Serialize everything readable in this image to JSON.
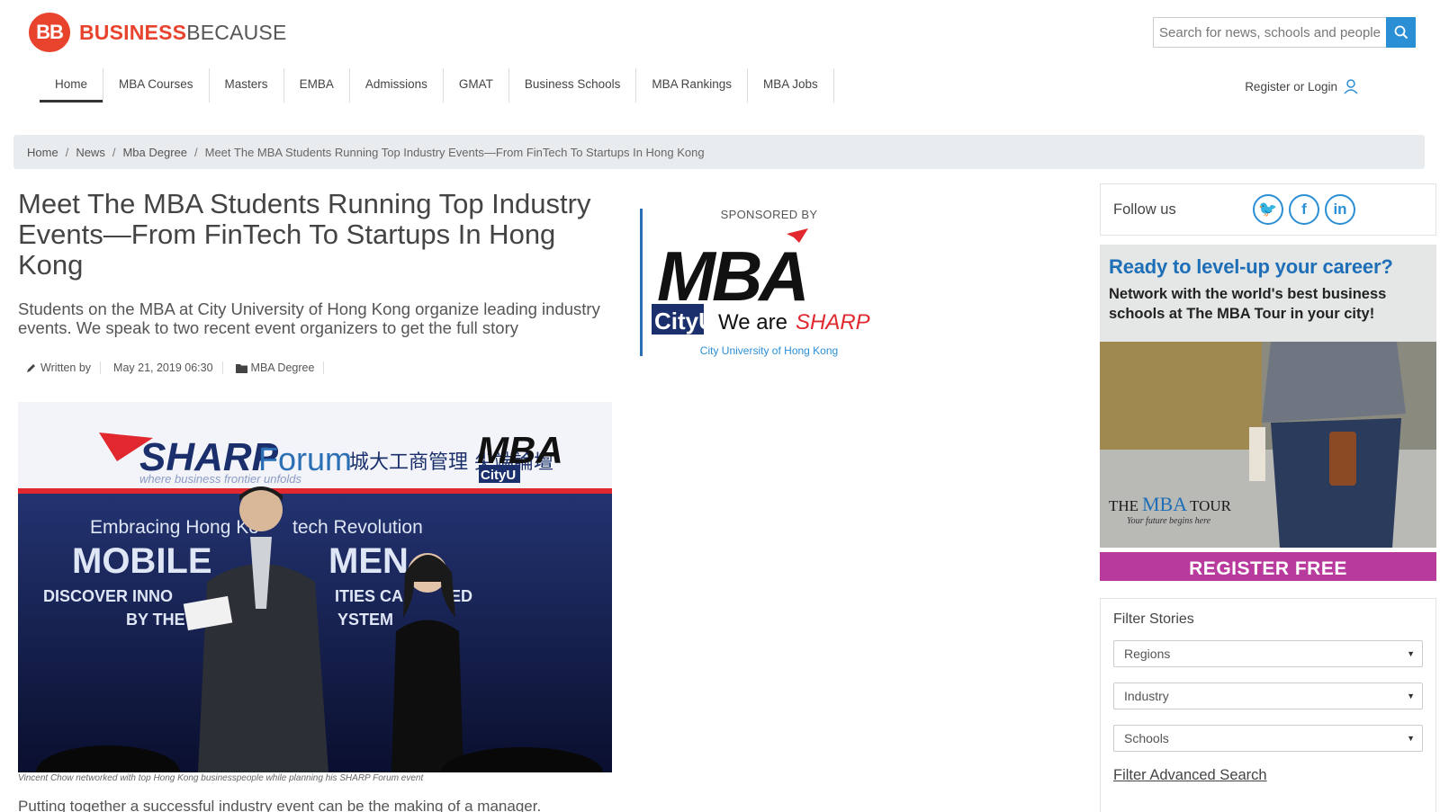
{
  "header": {
    "logo_badge": "BB",
    "logo_brand_part1": "BUSINESS",
    "logo_brand_part2": "BECAUSE",
    "search_placeholder": "Search for news, schools and people...",
    "register_label": "Register or Login"
  },
  "nav": {
    "items": [
      "Home",
      "MBA Courses",
      "Masters",
      "EMBA",
      "Admissions",
      "GMAT",
      "Business Schools",
      "MBA Rankings",
      "MBA Jobs"
    ],
    "active": "Home"
  },
  "breadcrumb": {
    "items": [
      "Home",
      "News",
      "Mba Degree"
    ],
    "current": "Meet The MBA Students Running Top Industry Events—From FinTech To Startups In Hong Kong"
  },
  "article": {
    "title": "Meet The MBA Students Running Top Industry Events—From FinTech To Startups In Hong Kong",
    "subtitle": "Students on the MBA at City University of Hong Kong organize leading industry events. We speak to two recent event organizers to get the full story",
    "written_by": "Written by",
    "date": "May 21, 2019 06:30",
    "category": "MBA Degree",
    "photo_caption": "Vincent Chow networked with top Hong Kong businesspeople while planning his SHARP Forum event",
    "lead": "Putting together a successful industry event can be the making of a manager."
  },
  "photo": {
    "banner_brand": "SHARP",
    "banner_forum": "Forum",
    "banner_tagline": "where business frontier unfolds",
    "banner_chinese": "城大工商管理 尖端論壇",
    "banner_mba": "MBA",
    "banner_cityu": "CityU",
    "screen_line1": "Embracing Hong Ko",
    "screen_line1b": "tech Revolution",
    "screen_line2": "MOBILE",
    "screen_line2b": "MEN",
    "screen_line3": "DISCOVER INNO",
    "screen_line3b": "ITIES CA",
    "screen_line3c": "ED",
    "screen_line4": "BY THE",
    "screen_line4b": "YSTEM"
  },
  "sponsor": {
    "label": "SPONSORED BY",
    "logo_mba": "MBA",
    "logo_cityu": "CityU",
    "logo_tagline_plain": "We are",
    "logo_tagline_accent": "SHARP",
    "caption": "City University of Hong Kong"
  },
  "sidebar": {
    "follow_label": "Follow us",
    "social": [
      "twitter-icon",
      "facebook-icon",
      "linkedin-icon"
    ],
    "social_glyphs": {
      "twitter": "🐦",
      "facebook": "f",
      "linkedin": "in"
    },
    "ad": {
      "headline": "Ready to level-up your career?",
      "subline": "Network with the world's best business schools at The MBA Tour in your city!",
      "logo_the": "THE",
      "logo_mba": "MBA",
      "logo_tour": "TOUR",
      "logo_tagline": "Your future begins here",
      "cta": "REGISTER FREE"
    },
    "filter": {
      "title": "Filter Stories",
      "selects": [
        "Regions",
        "Industry",
        "Schools"
      ],
      "advanced": "Filter Advanced Search"
    }
  },
  "colors": {
    "brand_red": "#e8432d",
    "accent_blue": "#2b8fd6",
    "ad_purple": "#b73a9c",
    "breadcrumb_bg": "#e9ecef"
  }
}
